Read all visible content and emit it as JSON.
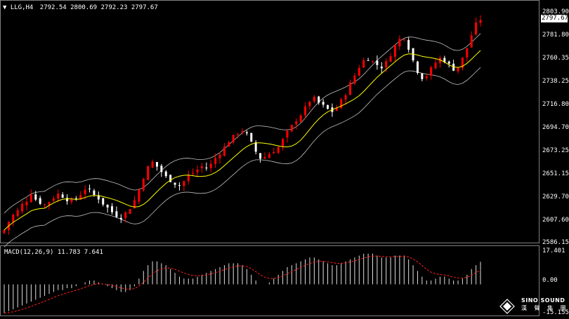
{
  "header": {
    "dropdown_icon": "triangle-down-icon",
    "symbol": "LLG,H4",
    "ohlc": "2792.54 2800.69 2792.23 2797.67"
  },
  "price_axis": {
    "ticks": [
      "2803.90",
      "2781.80",
      "2760.35",
      "2738.25",
      "2716.80",
      "2694.70",
      "2673.25",
      "2651.15",
      "2629.70",
      "2607.60",
      "2586.15"
    ],
    "current_price": "2797.67"
  },
  "macd_panel": {
    "label": "MACD(12,26,9) 11.783 7.641",
    "ticks": [
      "17.401",
      "0.00",
      "-15.155"
    ]
  },
  "watermark": {
    "brand": "SINO SOUND",
    "sub": "漢 聲 集 團",
    "icon": "diamond-logo-icon"
  },
  "colors": {
    "background": "#000000",
    "bull": "#ff0000",
    "bear": "#ffffff",
    "signal": "#ff2020",
    "ma": "#ffff00",
    "band": "#c0c0c0"
  },
  "chart_data": {
    "type": "candlestick",
    "price_range": [
      2586.15,
      2803.9
    ],
    "macd_range": [
      -15.155,
      17.401
    ],
    "close_path": [
      2598,
      2606,
      2612,
      2616,
      2622,
      2626,
      2633,
      2627,
      2624,
      2622,
      2625,
      2629,
      2632,
      2630,
      2627,
      2625,
      2628,
      2632,
      2637,
      2635,
      2631,
      2628,
      2623,
      2619,
      2615,
      2612,
      2610,
      2614,
      2619,
      2626,
      2636,
      2648,
      2657,
      2662,
      2658,
      2653,
      2648,
      2645,
      2642,
      2640,
      2644,
      2649,
      2652,
      2655,
      2658,
      2657,
      2660,
      2666,
      2671,
      2676,
      2682,
      2686,
      2690,
      2692,
      2688,
      2680,
      2672,
      2666,
      2667,
      2670,
      2673,
      2676,
      2683,
      2690,
      2696,
      2702,
      2707,
      2713,
      2720,
      2722,
      2718,
      2715,
      2712,
      2710,
      2714,
      2720,
      2727,
      2736,
      2744,
      2752,
      2758,
      2760,
      2757,
      2754,
      2752,
      2756,
      2764,
      2772,
      2778,
      2780,
      2770,
      2758,
      2748,
      2742,
      2744,
      2750,
      2756,
      2760,
      2758,
      2754,
      2750,
      2752,
      2760,
      2770,
      2782,
      2792,
      2797
    ],
    "macd_path": [
      -15,
      -14,
      -13,
      -12,
      -11,
      -10,
      -9,
      -8,
      -7,
      -6,
      -5,
      -4,
      -3,
      -3,
      -2,
      -2,
      -1,
      0,
      1,
      2,
      2,
      1,
      0,
      -1,
      -2,
      -3,
      -4,
      -4,
      -3,
      -1,
      3,
      7,
      10,
      12,
      12,
      11,
      10,
      8,
      6,
      4,
      3,
      3,
      3,
      4,
      5,
      6,
      7,
      8,
      9,
      10,
      11,
      11,
      11,
      10,
      8,
      5,
      2,
      0,
      0,
      1,
      3,
      5,
      7,
      9,
      10,
      11,
      12,
      13,
      14,
      14,
      13,
      12,
      11,
      10,
      10,
      11,
      12,
      13,
      14,
      15,
      16,
      16,
      16,
      15,
      14,
      14,
      14,
      15,
      15,
      15,
      13,
      10,
      7,
      4,
      2,
      2,
      3,
      4,
      4,
      3,
      2,
      2,
      3,
      5,
      8,
      10,
      11.783
    ]
  }
}
